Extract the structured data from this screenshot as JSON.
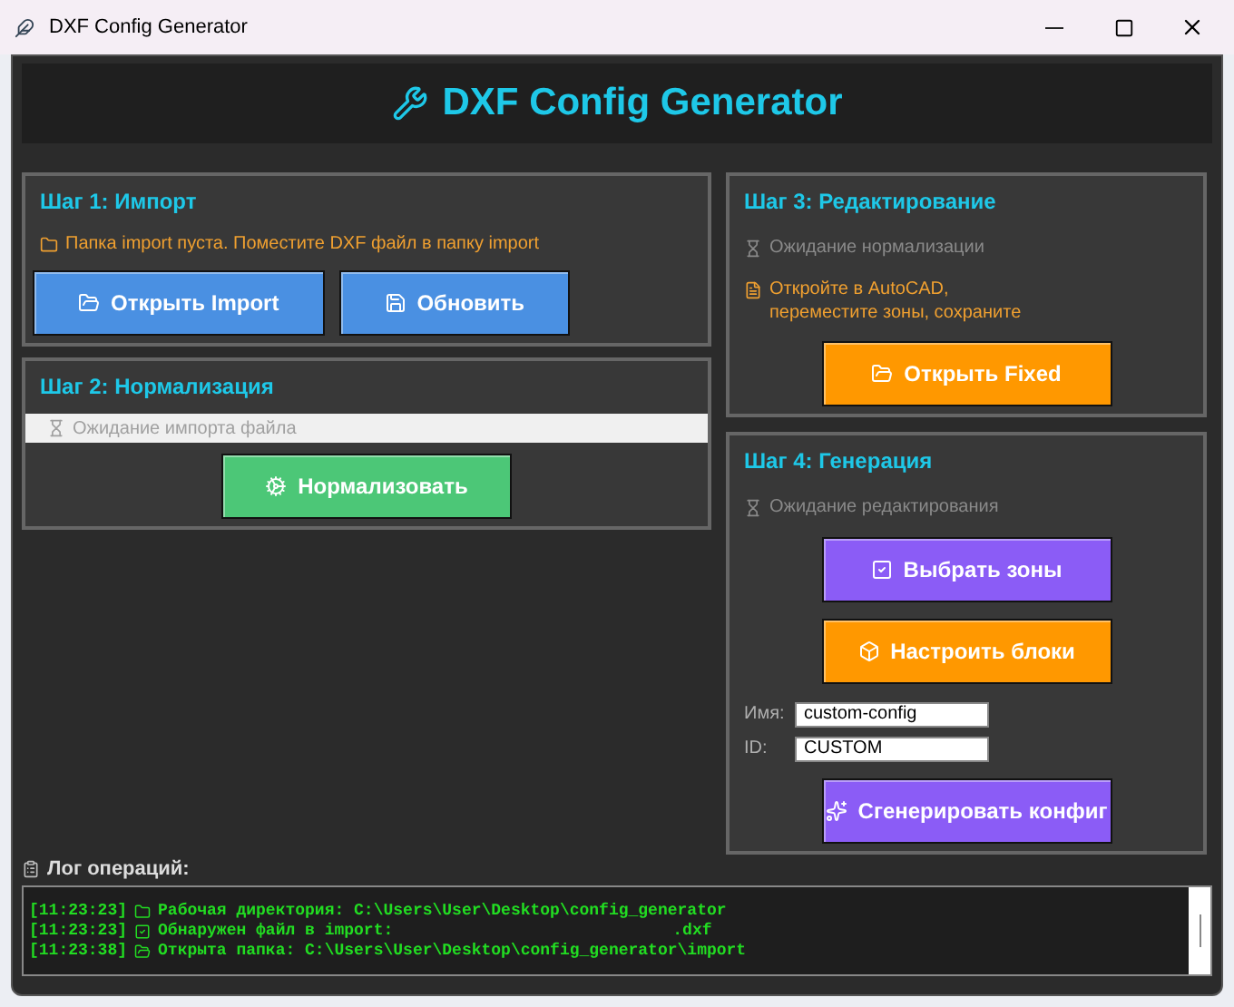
{
  "window": {
    "title": "DXF Config Generator"
  },
  "header": {
    "title": "DXF Config Generator"
  },
  "left_steps": [
    {
      "title": "Шаг 1: Импорт",
      "items": [
        {
          "kind": "notice",
          "text": "Папка import пуста. Поместите DXF файл в папку import"
        },
        {
          "kind": "buttons",
          "buttons": [
            {
              "label": "Открыть Import",
              "color": "#4a90e2"
            },
            {
              "label": "Обновить",
              "color": "#4a90e2"
            }
          ]
        }
      ]
    },
    {
      "title": "Шаг 2: Нормализация",
      "items": [
        {
          "kind": "status_bar",
          "text": "Ожидание импорта файла"
        },
        {
          "kind": "buttons",
          "buttons": [
            {
              "label": "Нормализовать",
              "color": "#4cc777"
            }
          ]
        }
      ]
    }
  ],
  "right_steps": [
    {
      "title": "Шаг 3: Редактирование",
      "items": [
        {
          "kind": "waiting",
          "text": "Ожидание нормализации"
        },
        {
          "kind": "notice",
          "text": "Откройте в AutoCAD,\nпереместите зоны, сохраните"
        },
        {
          "kind": "buttons",
          "buttons": [
            {
              "label": "Открыть Fixed",
              "color": "#ff9800"
            }
          ]
        }
      ]
    },
    {
      "title": "Шаг 4: Генерация",
      "items": [
        {
          "kind": "waiting",
          "text": "Ожидание редактирования"
        },
        {
          "kind": "buttons",
          "buttons": [
            {
              "label": "Выбрать зоны",
              "color": "#8b5cf6"
            }
          ]
        },
        {
          "kind": "buttons",
          "buttons": [
            {
              "label": "Настроить блоки",
              "color": "#ff9800"
            }
          ]
        },
        {
          "kind": "fields",
          "fields": [
            {
              "label": "Имя:",
              "value": "custom-config"
            },
            {
              "label": "ID:",
              "value": "CUSTOM"
            }
          ]
        },
        {
          "kind": "buttons",
          "buttons": [
            {
              "label": "Сгенерировать конфиг",
              "color": "#8b5cf6"
            }
          ]
        }
      ]
    }
  ],
  "log": {
    "title": "Лог операций:",
    "lines": [
      {
        "time": "[11:23:23]",
        "text": "Рабочая директория: C:\\Users\\User\\Desktop\\config_generator"
      },
      {
        "time": "[11:23:23]",
        "text": "Обнаружен файл в import:",
        "suffix": ".dxf"
      },
      {
        "time": "[11:23:38]",
        "text": "Открыта папка: C:\\Users\\User\\Desktop\\config_generator\\import"
      }
    ]
  }
}
